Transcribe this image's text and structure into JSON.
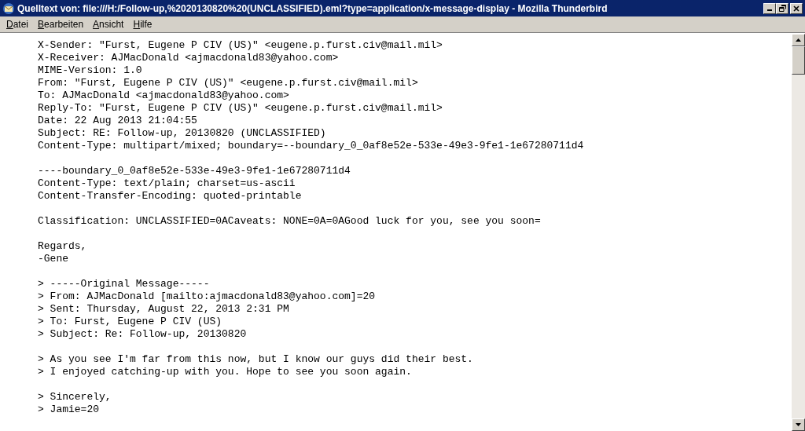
{
  "window": {
    "title": "Quelltext von: file:///H:/Follow-up,%2020130820%20(UNCLASSIFIED).eml?type=application/x-message-display - Mozilla Thunderbird"
  },
  "menu": [
    "Datei",
    "Bearbeiten",
    "Ansicht",
    "Hilfe"
  ],
  "source_blocks": [
    [
      "X-Sender: \"Furst, Eugene P CIV (US)\" <eugene.p.furst.civ@mail.mil>",
      "X-Receiver: AJMacDonald <ajmacdonald83@yahoo.com>",
      "MIME-Version: 1.0",
      "From: \"Furst, Eugene P CIV (US)\" <eugene.p.furst.civ@mail.mil>",
      "To: AJMacDonald <ajmacdonald83@yahoo.com>",
      "Reply-To: \"Furst, Eugene P CIV (US)\" <eugene.p.furst.civ@mail.mil>",
      "Date: 22 Aug 2013 21:04:55",
      "Subject: RE: Follow-up, 20130820 (UNCLASSIFIED)",
      "Content-Type: multipart/mixed; boundary=--boundary_0_0af8e52e-533e-49e3-9fe1-1e67280711d4"
    ],
    [
      "----boundary_0_0af8e52e-533e-49e3-9fe1-1e67280711d4",
      "Content-Type: text/plain; charset=us-ascii",
      "Content-Transfer-Encoding: quoted-printable"
    ],
    [
      "Classification: UNCLASSIFIED=0ACaveats: NONE=0A=0AGood luck for you, see you soon="
    ],
    [
      "Regards,",
      "-Gene"
    ],
    [
      "> -----Original Message-----",
      "> From: AJMacDonald [mailto:ajmacdonald83@yahoo.com]=20",
      "> Sent: Thursday, August 22, 2013 2:31 PM",
      "> To: Furst, Eugene P CIV (US)",
      "> Subject: Re: Follow-up, 20130820"
    ],
    [
      "> As you see I'm far from this now, but I know our guys did their best.",
      "> I enjoyed catching-up with you. Hope to see you soon again."
    ],
    [
      "> Sincerely,",
      "> Jamie=20"
    ]
  ]
}
